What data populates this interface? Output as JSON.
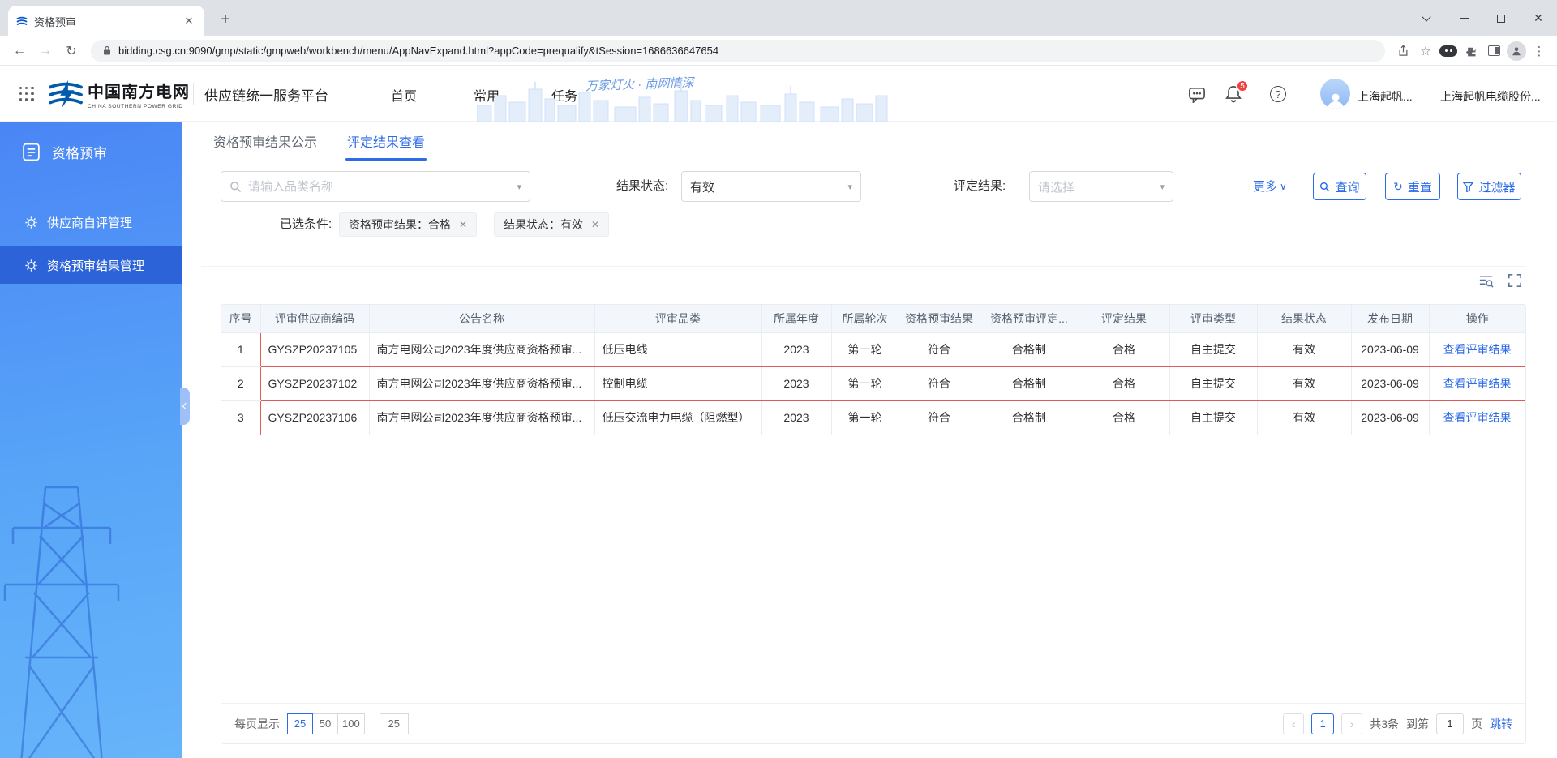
{
  "colors": {
    "accent": "#2e6be6",
    "sidebar_active": "#2d63d9",
    "row_highlight_border": "#e05a5a",
    "badge_red": "#f53f3f",
    "brand_blue": "#005bac"
  },
  "icons": {
    "back": "←",
    "forward": "→",
    "reload": "↻",
    "star": "☆",
    "menu": "⋮",
    "plus": "+",
    "close": "✕",
    "caret_down": "▾",
    "chevron_down": "∨",
    "help": "?"
  },
  "browser": {
    "tab_title": "资格预审",
    "url": "bidding.csg.cn:9090/gmp/static/gmpweb/workbench/menu/AppNavExpand.html?appCode=prequalify&tSession=1686636647654"
  },
  "header": {
    "brand": "中国南方电网",
    "brand_en": "CHINA SOUTHERN POWER GRID",
    "platform": "供应链统一服务平台",
    "nav": [
      {
        "label": "首页"
      },
      {
        "label": "常用"
      },
      {
        "label": "任务"
      }
    ],
    "slogan": "万家灯火 · 南网情深",
    "badge_count": "5",
    "user_short": "上海起帆...",
    "user_full": "上海起帆电缆股份..."
  },
  "sidebar": {
    "items": [
      {
        "label": "资格预审"
      },
      {
        "label": "供应商自评管理"
      },
      {
        "label": "资格预审结果管理"
      }
    ]
  },
  "main": {
    "tabs": [
      {
        "label": "资格预审结果公示"
      },
      {
        "label": "评定结果查看"
      }
    ],
    "filters": {
      "search_placeholder": "请输入品类名称",
      "status_label": "结果状态:",
      "status_value": "有效",
      "result_label": "评定结果:",
      "result_placeholder": "请选择",
      "more_label": "更多",
      "query_label": "查询",
      "reset_label": "重置",
      "filter_label": "过滤器"
    },
    "selected": {
      "label": "已选条件:",
      "tags": [
        "资格预审结果：合格",
        "结果状态：有效"
      ]
    },
    "table": {
      "columns": [
        "序号",
        "评审供应商编码",
        "公告名称",
        "评审品类",
        "所属年度",
        "所属轮次",
        "资格预审结果",
        "资格预审评定...",
        "评定结果",
        "评审类型",
        "结果状态",
        "发布日期",
        "操作"
      ],
      "rows": [
        {
          "no": "1",
          "code": "GYSZP20237105",
          "announcement": "南方电网公司2023年度供应商资格预审...",
          "category": "低压电线",
          "year": "2023",
          "round": "第一轮",
          "prequalify_result": "符合",
          "prequalify_eval": "合格制",
          "eval_result": "合格",
          "review_type": "自主提交",
          "status": "有效",
          "date": "2023-06-09",
          "action": "查看评审结果"
        },
        {
          "no": "2",
          "code": "GYSZP20237102",
          "announcement": "南方电网公司2023年度供应商资格预审...",
          "category": "控制电缆",
          "year": "2023",
          "round": "第一轮",
          "prequalify_result": "符合",
          "prequalify_eval": "合格制",
          "eval_result": "合格",
          "review_type": "自主提交",
          "status": "有效",
          "date": "2023-06-09",
          "action": "查看评审结果"
        },
        {
          "no": "3",
          "code": "GYSZP20237106",
          "announcement": "南方电网公司2023年度供应商资格预审...",
          "category": "低压交流电力电缆（阻燃型）",
          "year": "2023",
          "round": "第一轮",
          "prequalify_result": "符合",
          "prequalify_eval": "合格制",
          "eval_result": "合格",
          "review_type": "自主提交",
          "status": "有效",
          "date": "2023-06-09",
          "action": "查看评审结果"
        }
      ]
    },
    "pagination": {
      "per_page_label": "每页显示",
      "page_sizes": [
        "25",
        "50",
        "100"
      ],
      "active_size": "25",
      "size_display": "25",
      "prev": "‹",
      "next": "›",
      "current_page": "1",
      "total_label": "共3条",
      "goto_prefix": "到第",
      "goto_value": "1",
      "goto_suffix": "页",
      "jump_label": "跳转"
    }
  }
}
